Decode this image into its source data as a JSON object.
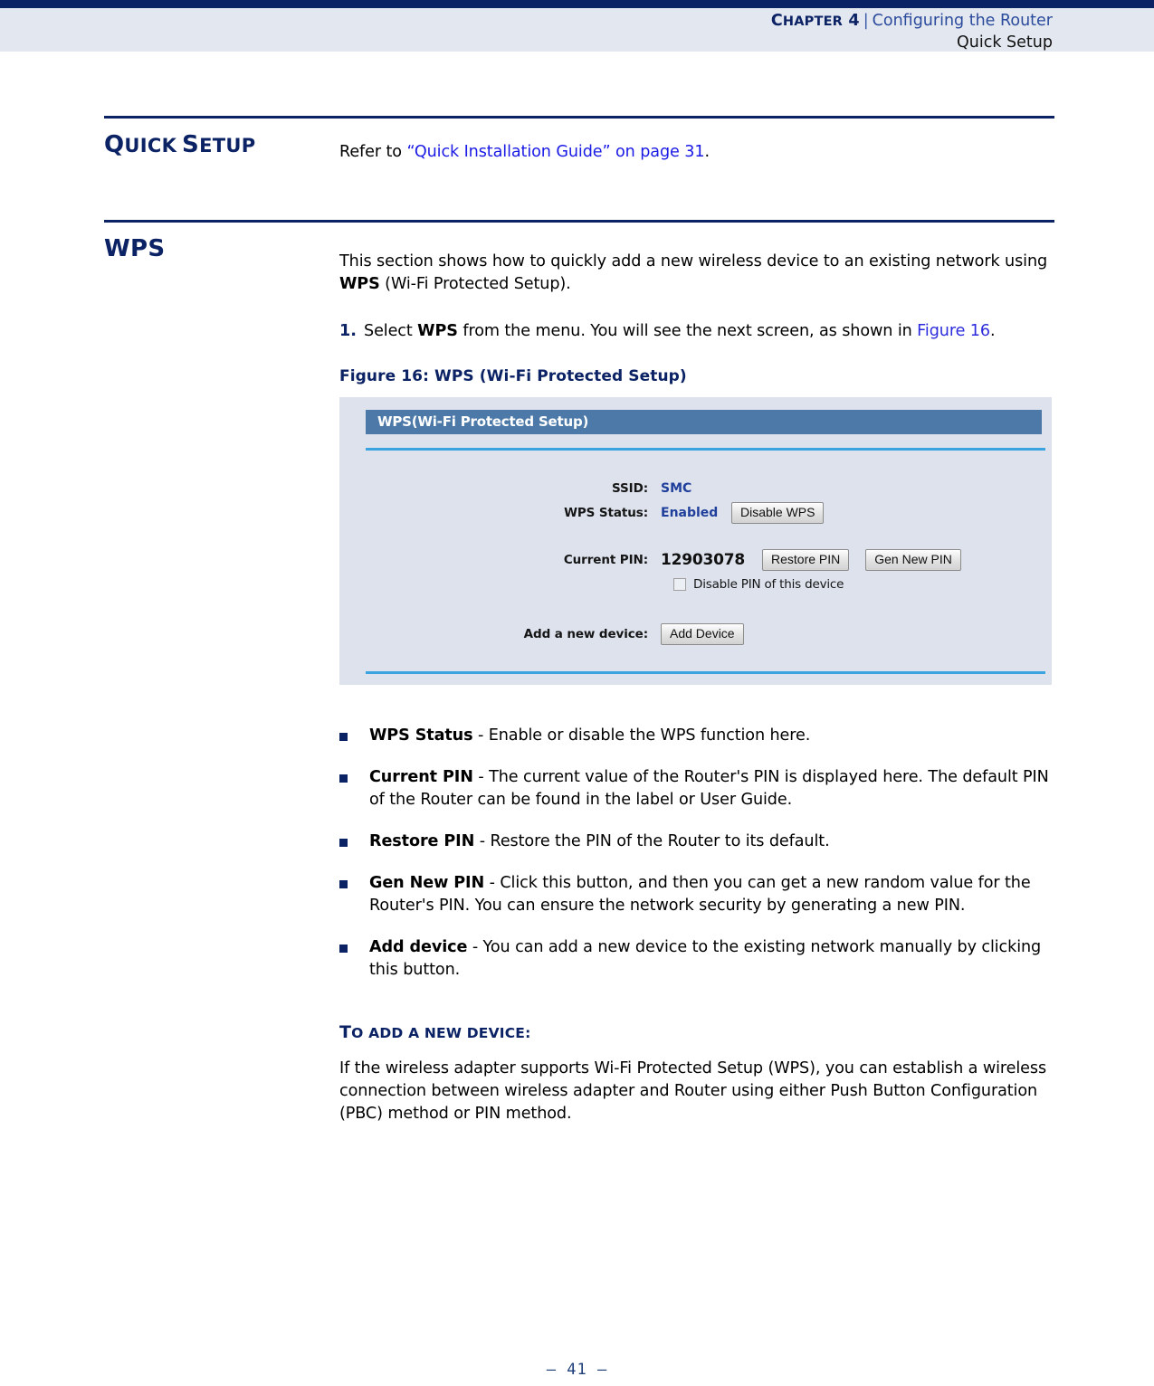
{
  "header": {
    "chapter_label_cap": "C",
    "chapter_label_rest": "HAPTER",
    "chapter_number": "4",
    "separator": "|",
    "doc_title": "Configuring the Router",
    "subtitle": "Quick Setup"
  },
  "sections": {
    "quick_setup": {
      "title_cap_1": "Q",
      "title_small_1": "UICK",
      "title_cap_2": "S",
      "title_small_2": "ETUP",
      "body_prefix": "Refer to ",
      "body_link": "“Quick Installation Guide” on page 31",
      "body_suffix": "."
    },
    "wps": {
      "title": "WPS",
      "intro_part1": "This section shows how to quickly add a new wireless device to an existing network using ",
      "intro_bold": "WPS",
      "intro_part2": " (Wi-Fi Protected Setup).",
      "step_number": "1.",
      "step_part1": "Select ",
      "step_bold": "WPS",
      "step_part2": " from the menu. You will see the next screen, as shown in ",
      "step_link": "Figure 16",
      "step_part3": ".",
      "figure_caption": "Figure 16:  WPS (Wi-Fi Protected Setup)"
    }
  },
  "screenshot": {
    "titlebar": "WPS(Wi-Fi Protected Setup)",
    "rows": [
      {
        "label": "SSID:",
        "value": "SMC"
      },
      {
        "label": "WPS Status:",
        "value": "Enabled",
        "button": "Disable WPS"
      }
    ],
    "pin_row": {
      "label": "Current PIN:",
      "value": "12903078",
      "button_restore": "Restore PIN",
      "button_gen": "Gen New PIN"
    },
    "checkbox": {
      "label": "Disable PIN of this device",
      "checked": false
    },
    "add_device_row": {
      "label": "Add a new device:",
      "button": "Add Device"
    }
  },
  "bullets": [
    {
      "term": "WPS Status",
      "desc": " - Enable or disable the WPS function here."
    },
    {
      "term": "Current PIN",
      "desc": " - The current value of the Router's PIN is displayed here. The default PIN of the Router can be found in the label or User Guide."
    },
    {
      "term": "Restore PIN",
      "desc": " - Restore the PIN of the Router to its default."
    },
    {
      "term": "Gen New PIN",
      "desc": " - Click this button, and then you can get a new random value for the Router's PIN. You can ensure the network security by generating a new PIN."
    },
    {
      "term": "Add device",
      "desc": " - You can add a new device to the existing network manually by clicking this button."
    }
  ],
  "add_device_section": {
    "heading_cap_1": "T",
    "heading_small_1": "O ADD A NEW DEVICE:",
    "paragraph": "If the wireless adapter supports Wi-Fi Protected Setup (WPS), you can establish a wireless connection between wireless adapter and Router using either Push Button Configuration (PBC) method or PIN method."
  },
  "footer": {
    "page_number": "–  41  –"
  },
  "colors": {
    "navy": "#0b2265",
    "header_band": "#e3e7f0",
    "link_blue": "#1a1ae6",
    "screenshot_bg": "#dde2ed",
    "titlebar_blue": "#4d79a8",
    "rule_blue": "#3ba3e0"
  }
}
